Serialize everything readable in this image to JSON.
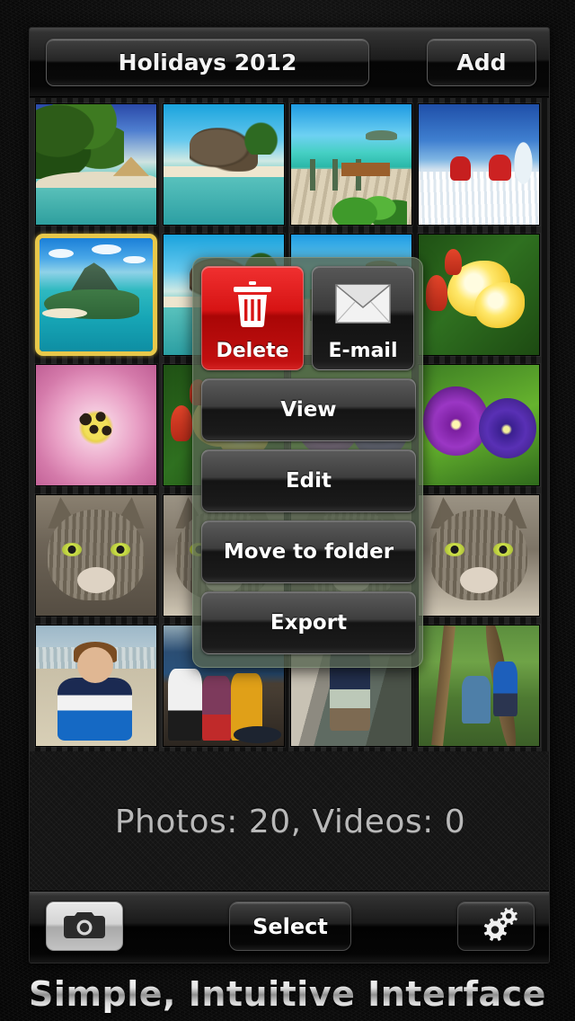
{
  "app": {
    "header": {
      "album_label": "Holidays 2012",
      "add_label": "Add"
    },
    "counter_text": "Photos: 20, Videos: 0",
    "toolbar": {
      "camera_icon": "camera-icon",
      "select_label": "Select",
      "settings_icon": "gears-icon"
    },
    "action_menu": {
      "delete_label": "Delete",
      "delete_icon": "trash-icon",
      "delete_color": "#d71414",
      "email_label": "E-mail",
      "email_icon": "envelope-icon",
      "items": [
        {
          "label": "View"
        },
        {
          "label": "Edit"
        },
        {
          "label": "Move to folder"
        },
        {
          "label": "Export"
        }
      ]
    },
    "grid": {
      "selection_color": "#e8c84a",
      "thumbnails": [
        {
          "name": "tropical-palms-lagoon",
          "scene": "p-palms",
          "selected": false
        },
        {
          "name": "rocky-beach-seychelles",
          "scene": "p-rocks",
          "selected": false
        },
        {
          "name": "beach-boardwalk",
          "scene": "p-board",
          "selected": false
        },
        {
          "name": "skiers-snow-slope",
          "scene": "p-ski",
          "selected": false
        },
        {
          "name": "island-aerial-mountain",
          "scene": "p-island",
          "selected": true
        },
        {
          "name": "rocky-beach-seychelles",
          "scene": "p-rocks",
          "selected": false
        },
        {
          "name": "beach-boardwalk",
          "scene": "p-board",
          "selected": false
        },
        {
          "name": "yellow-plumeria-flower",
          "scene": "p-plum",
          "selected": false
        },
        {
          "name": "pink-daisy-flower",
          "scene": "p-daisy",
          "selected": false
        },
        {
          "name": "red-flowers-green",
          "scene": "p-plum",
          "selected": false
        },
        {
          "name": "purple-pansies",
          "scene": "p-pansy",
          "selected": false
        },
        {
          "name": "purple-pansies",
          "scene": "p-pansy",
          "selected": false
        },
        {
          "name": "grey-tabby-cat",
          "scene": "p-cat",
          "selected": false
        },
        {
          "name": "grey-tabby-cat",
          "scene": "p-cat",
          "selected": false
        },
        {
          "name": "tabby-cat-closeup",
          "scene": "p-cat",
          "selected": false
        },
        {
          "name": "tabby-cat-closeup",
          "scene": "p-cat",
          "selected": false
        },
        {
          "name": "boy-blue-jacket-beach",
          "scene": "p-boy",
          "selected": false
        },
        {
          "name": "kids-by-the-sea",
          "scene": "p-kids",
          "selected": false
        },
        {
          "name": "boy-by-rock-wall",
          "scene": "p-rock",
          "selected": false
        },
        {
          "name": "family-in-forest",
          "scene": "p-forest",
          "selected": false
        }
      ]
    }
  },
  "caption": "Simple, Intuitive Interface"
}
